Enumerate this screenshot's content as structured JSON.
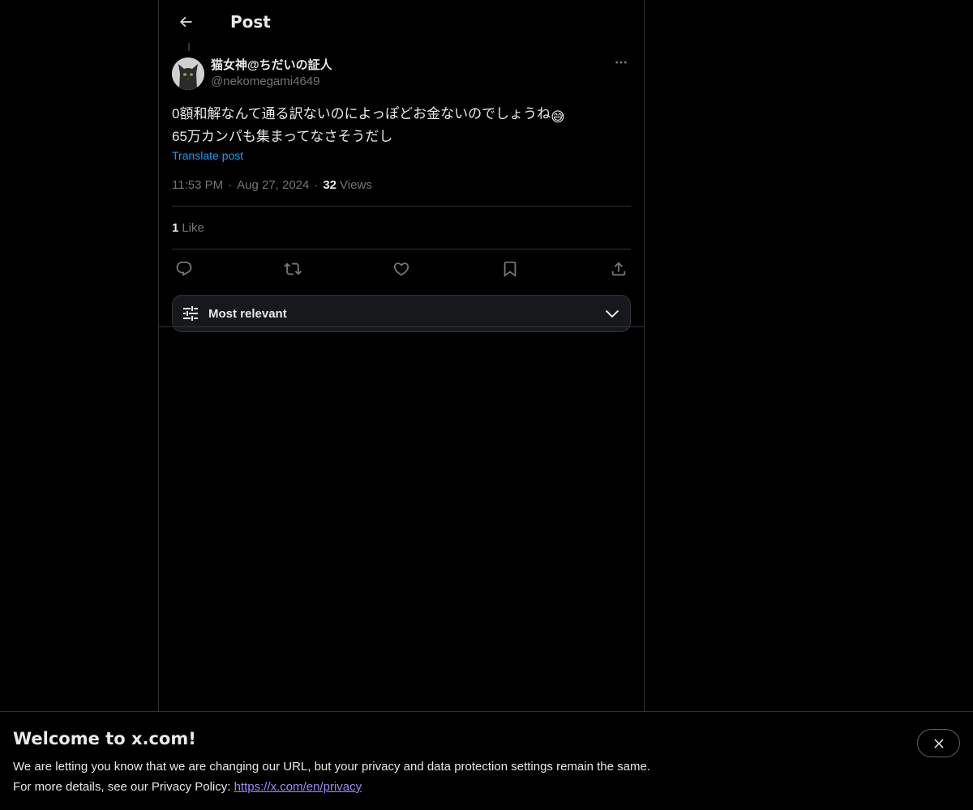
{
  "header": {
    "title": "Post"
  },
  "post": {
    "display_name": "猫女神@ちだいの証人",
    "handle": "@nekomegami4649",
    "text_line1": "0額和解なんて通る訳ないのによっぽどお金ないのでしょうね",
    "text_line1_emoji": "😅",
    "text_line2": "65万カンパも集まってなさそうだし",
    "translate_label": "Translate post",
    "time": "11:53 PM",
    "date": "Aug 27, 2024",
    "views_count": "32",
    "views_label": "Views",
    "likes_count": "1",
    "likes_label": "Like",
    "separator": "·"
  },
  "icons": {
    "back": "arrow-left-icon",
    "more": "more-horizontal-icon",
    "reply": "reply-icon",
    "repost": "repost-icon",
    "like": "heart-icon",
    "bookmark": "bookmark-icon",
    "share": "share-icon",
    "sort": "sliders-icon",
    "chevron": "chevron-down-icon",
    "close": "close-icon"
  },
  "replies_sort": {
    "label": "Most relevant"
  },
  "banner": {
    "title": "Welcome to x.com!",
    "line1": "We are letting you know that we are changing our URL, but your privacy and data protection settings remain the same.",
    "line2_prefix": "For more details, see our Privacy Policy: ",
    "link_text": "https://x.com/en/privacy"
  },
  "colors": {
    "background": "#000000",
    "text_primary": "#e7e9ea",
    "text_secondary": "#71767b",
    "accent": "#1d9bf0",
    "border": "#2f3336",
    "link_visited": "#9a8cf5"
  }
}
